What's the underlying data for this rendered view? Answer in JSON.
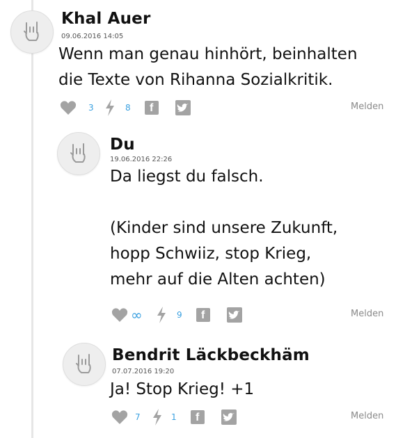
{
  "comments": [
    {
      "author": "Khal Auer",
      "date": "09.06.2016 14:05",
      "text": "Wenn man genau hinhört, beinhalten\ndie Texte von Rihanna Sozialkritik.",
      "likes": "3",
      "shares": "8",
      "report_label": "Melden"
    },
    {
      "author": "Du",
      "date": "19.06.2016 22:26",
      "text": "Da liegst du falsch.\n\n(Kinder sind unsere Zukunft,\nhopp Schwiiz, stop Krieg,\nmehr auf die Alten achten)",
      "likes": "∞",
      "shares": "9",
      "report_label": "Melden"
    },
    {
      "author": "Bendrit Läckbeckhäm",
      "date": "07.07.2016 19:20",
      "text": "Ja! Stop Krieg! +1",
      "likes": "7",
      "shares": "1",
      "report_label": "Melden"
    }
  ],
  "colors": {
    "count_blue": "#3aa0e0",
    "icon_gray": "#a3a3a3",
    "text_dark": "#111111"
  },
  "icons": {
    "avatar": "rock-hand-icon",
    "like": "heart-icon",
    "share": "lightning-icon",
    "facebook": "facebook-icon",
    "twitter": "twitter-icon"
  }
}
